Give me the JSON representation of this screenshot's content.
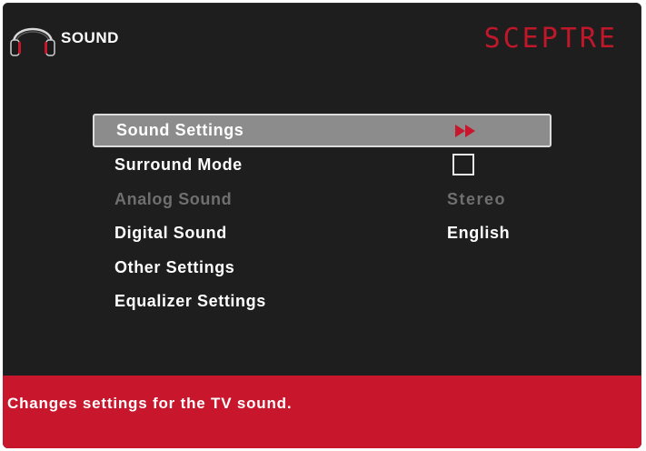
{
  "header": {
    "title": "SOUND",
    "brand": "SCEPTRE",
    "icon": "headphones-icon"
  },
  "colors": {
    "background": "#1e1e1e",
    "accent": "#c8162c",
    "brand": "#c0182a",
    "selected_row": "#8c8c8c",
    "disabled_text": "#6f6f6f"
  },
  "menu": {
    "items": [
      {
        "label": "Sound Settings",
        "control": "arrow",
        "icon": "double-arrow-right-icon",
        "selected": true
      },
      {
        "label": "Surround Mode",
        "control": "checkbox",
        "checked": false
      },
      {
        "label": "Analog Sound",
        "value": "Stereo",
        "disabled": true
      },
      {
        "label": "Digital Sound",
        "value": "English"
      },
      {
        "label": "Other Settings"
      },
      {
        "label": "Equalizer Settings"
      }
    ]
  },
  "help": {
    "text": "Changes settings for the TV sound."
  }
}
